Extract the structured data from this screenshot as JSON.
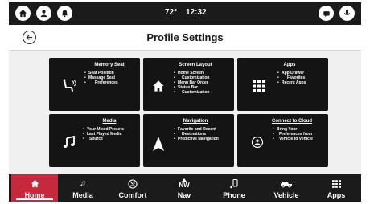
{
  "status_bar": {
    "temperature": "72°",
    "time": "12:32",
    "left_icons": [
      "home-icon",
      "user-icon",
      "bell-icon"
    ],
    "right_icons": [
      "message-icon",
      "microphone-icon"
    ]
  },
  "header": {
    "title": "Profile Settings",
    "back_icon": "back-arrow-icon"
  },
  "tiles": [
    {
      "title": "Memory Seat",
      "icon": "seat-icon",
      "items": [
        "Seat Position",
        "Massage Seat",
        "Preferences"
      ]
    },
    {
      "title": "Screen Layout",
      "icon": "home-icon",
      "items": [
        "Home Screen",
        "Customization",
        "Menu Bar Order",
        "Status Bar",
        "Customization"
      ]
    },
    {
      "title": "Apps",
      "icon": "app-grid-icon",
      "items": [
        "App Drawer",
        "Favorites",
        "Recent Apps"
      ]
    },
    {
      "title": "Media",
      "icon": "music-note-icon",
      "items": [
        "Your Mixed Presets",
        "Last Played Media",
        "Source"
      ]
    },
    {
      "title": "Navigation",
      "icon": "navigation-arrow-icon",
      "items": [
        "Favorite and Recent",
        "Destinations",
        "Predictive Navigation"
      ]
    },
    {
      "title": "Connect to Cloud",
      "icon": "cloud-user-icon",
      "items": [
        "Bring Your",
        "Preferences from",
        "Vehicle to Vehicle"
      ]
    }
  ],
  "nav": {
    "active": "Home",
    "items": [
      {
        "label": "Home",
        "icon": "home-icon",
        "glyph": ""
      },
      {
        "label": "Media",
        "icon": "music-note-icon",
        "glyph": "♫"
      },
      {
        "label": "Comfort",
        "icon": "comfort-icon",
        "glyph": ""
      },
      {
        "label": "Nav",
        "icon": "compass-icon",
        "glyph": "NW"
      },
      {
        "label": "Phone",
        "icon": "phone-icon",
        "glyph": ""
      },
      {
        "label": "Vehicle",
        "icon": "vehicle-icon",
        "glyph": ""
      },
      {
        "label": "Apps",
        "icon": "app-grid-icon",
        "glyph": ""
      }
    ]
  },
  "colors": {
    "bar_background": "#1b1b1b",
    "tile_background": "#141414",
    "active_tab": "#c8283c",
    "content_background": "#f0f0f0"
  }
}
